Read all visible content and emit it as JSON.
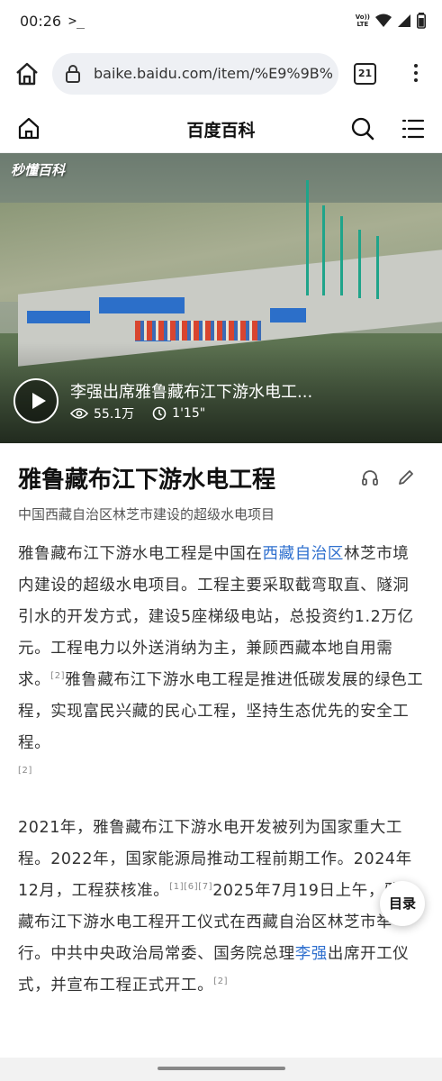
{
  "status_bar": {
    "time": "00:26",
    "terminal_glyph": ">_",
    "volte_label_top": "Vo))",
    "volte_label_bottom": "LTE"
  },
  "browser": {
    "url": "baike.baidu.com/item/%E9%9B%",
    "tab_count": "21"
  },
  "site_header": {
    "title": "百度百科"
  },
  "video": {
    "watermark": "秒懂百科",
    "title": "李强出席雅鲁藏布江下游水电工...",
    "views": "55.1万",
    "duration": "1'15\""
  },
  "article": {
    "title": "雅鲁藏布江下游水电工程",
    "subtitle": "中国西藏自治区林芝市建设的超级水电项目",
    "p1_a": "雅鲁藏布江下游水电工程是中国在",
    "p1_link": "西藏自治区",
    "p1_b": "林芝市境内建设的超级水电项目。工程主要采取截弯取直、隧洞引水的开发方式，建设5座梯级电站，总投资约1.2万亿元。工程电力以外送消纳为主，兼顾西藏本地自用需求。",
    "p1_ref1": "[2]",
    "p1_c": "雅鲁藏布江下游水电工程是推进低碳发展的绿色工程，实现富民兴藏的民心工程，坚持生态优先的安全工程。",
    "p1_ref2": "[2]",
    "p2_a": "2021年，雅鲁藏布江下游水电开发被列为国家重大工程。2022年，国家能源局推动工程前期工作。2024年12月，工程获核准。",
    "p2_ref1": "[1][6][7]",
    "p2_b": "2025年7月19日上午，雅鲁藏布江下游水电工程开工仪式在西藏自治区林芝市举行。中共中央政治局常委、国务院总理",
    "p2_link": "李强",
    "p2_c": "出席开工仪式，并宣布工程正式开工。",
    "p2_ref2": "[2]"
  },
  "toc_button": "目录",
  "colors": {
    "link": "#2e6fce",
    "rig": "#1fa48a",
    "container_blue": "#2c6fc9"
  }
}
